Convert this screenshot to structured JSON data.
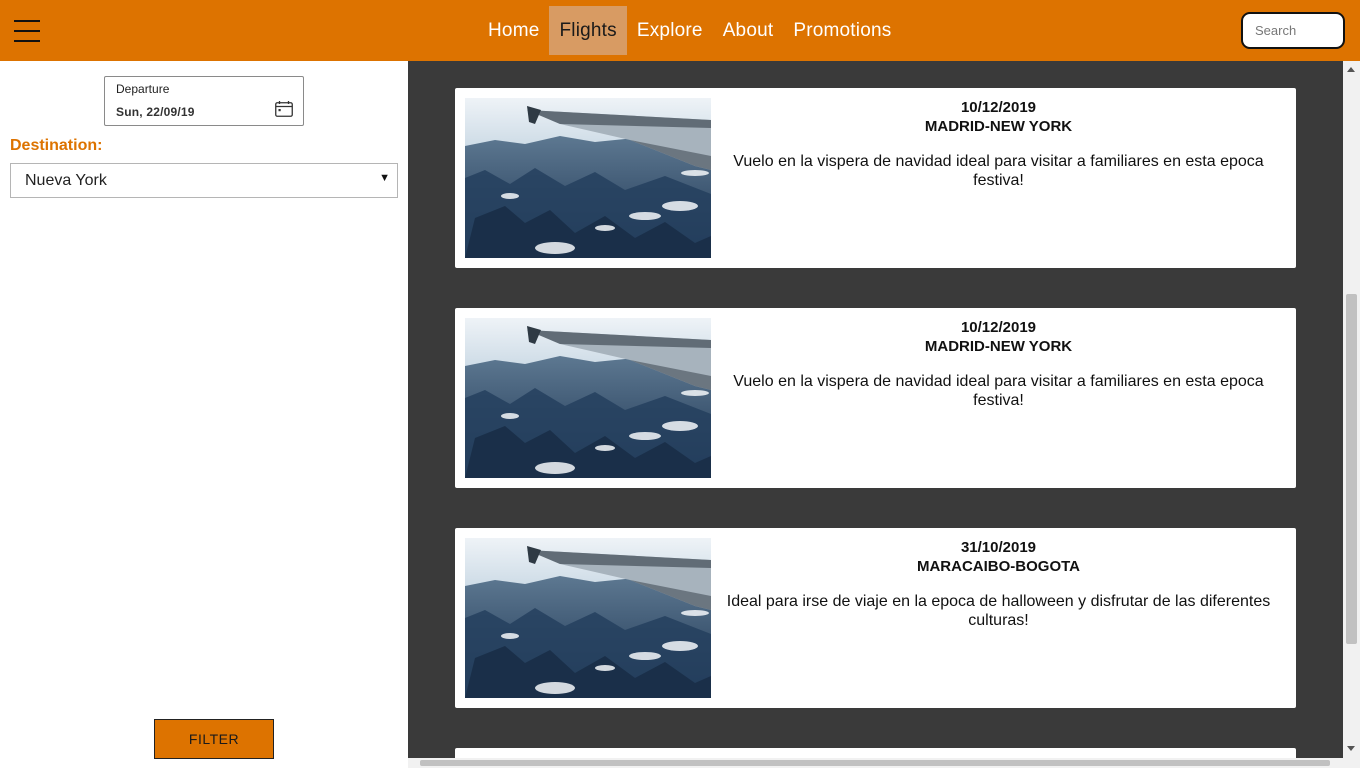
{
  "nav": {
    "menu_icon": "hamburger-menu-icon",
    "links": [
      {
        "label": "Home",
        "active": false
      },
      {
        "label": "Flights",
        "active": true
      },
      {
        "label": "Explore",
        "active": false
      },
      {
        "label": "About",
        "active": false
      },
      {
        "label": "Promotions",
        "active": false
      }
    ],
    "search_placeholder": "Search"
  },
  "sidebar": {
    "departure": {
      "label": "Departure",
      "value": "Sun, 22/09/19",
      "icon": "calendar-icon"
    },
    "destination": {
      "label": "Destination:",
      "value": "Nueva York"
    },
    "filter_label": "FILTER"
  },
  "flights": [
    {
      "date": "10/12/2019",
      "route": "MADRID-NEW YORK",
      "description": "Vuelo en la vispera de navidad ideal para visitar a familiares en esta epoca festiva!"
    },
    {
      "date": "10/12/2019",
      "route": "MADRID-NEW YORK",
      "description": "Vuelo en la vispera de navidad ideal para visitar a familiares en esta epoca festiva!"
    },
    {
      "date": "31/10/2019",
      "route": "MARACAIBO-BOGOTA",
      "description": "Ideal para irse de viaje en la epoca de halloween y disfrutar de las diferentes culturas!"
    }
  ],
  "colors": {
    "brand": "#dd7300",
    "active_tab": "#d89b63",
    "content_bg": "#3a3a3a"
  }
}
